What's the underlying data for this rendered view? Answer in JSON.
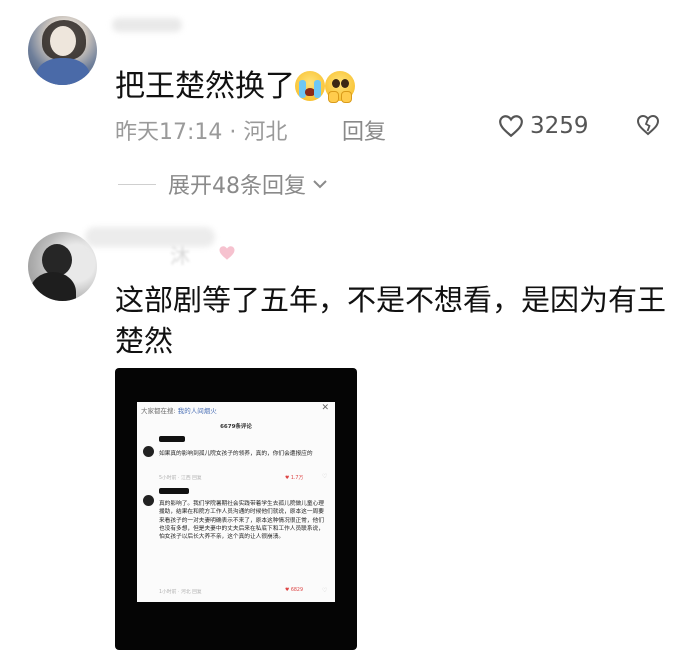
{
  "comment1": {
    "text": "把王楚然换了",
    "emojis": [
      "crying-face",
      "pleading-face"
    ],
    "time": "昨天17:14 · 河北",
    "reply_label": "回复",
    "likes": "3259",
    "expand_label": "展开48条回复"
  },
  "comment2": {
    "username_visible": "沐",
    "text": "这部剧等了五年，不是不想看，是因为有王楚然",
    "image": {
      "header_prefix": "大家都在搜:",
      "header_link": "我的人间烟火",
      "close": "✕",
      "comment_count": "6679条评论",
      "reply1_text": "如果真的影响到孤儿院女孩子的领养，真的，你们会遭报应的",
      "reply1_meta": "5小时前 · 江西  回复",
      "reply1_likes": "1.7万",
      "reply2_text": "真的影响了。我们学院暑期社会实践带着学生去孤儿院做儿童心理援助，结果在和院方工作人员沟通的时候他们就说，原本这一周要来看孩子的一对夫妻明确表示不来了，原本这种情况很正常，他们也没有多想，但是夫妻中的丈夫后来在私底下和工作人员联系说，怕女孩子以后长大养不亲，这个真的让人很崩溃。",
      "reply2_meta": "1小时前 · 河北  回复",
      "reply2_likes": "6829"
    }
  },
  "colors": {
    "text_primary": "#111111",
    "text_meta": "#9a9a9a",
    "link_blue": "#4a6fb5",
    "like_red": "#dd4444"
  }
}
